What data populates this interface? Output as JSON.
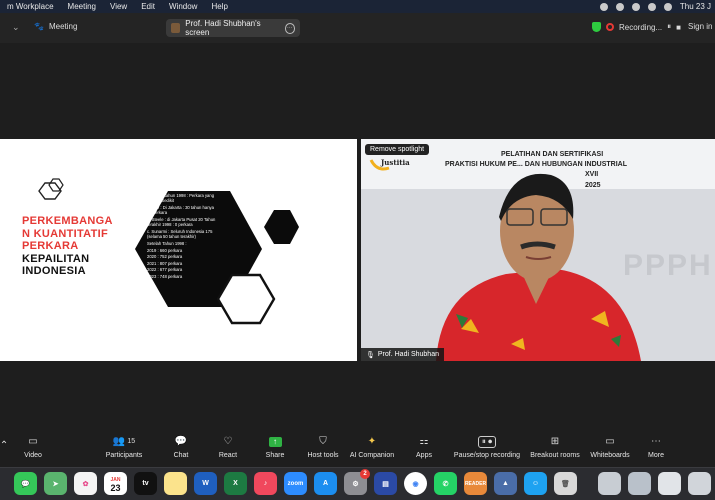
{
  "menubar": {
    "items": [
      "m Workplace",
      "Meeting",
      "View",
      "Edit",
      "Window",
      "Help"
    ],
    "clock": "Thu 23 J"
  },
  "titlebar": {
    "meeting_label": "Meeting",
    "share_pill": "Prof. Hadi Shubhan's screen",
    "recording": "Recording...",
    "sign_in": "Sign in"
  },
  "slide": {
    "title_red": [
      "PERKEMBANGA",
      "N KUANTITATIF",
      "PERKARA"
    ],
    "title_black": [
      "KEPAILITAN",
      "INDONESIA"
    ],
    "bullets": [
      "Sebelum tahun 1998 : Perkara yang Sangat Sedikit",
      "a.  Hoff : Di Jakarta : 30 tahun hanya 20 perkara",
      "b.  Steele : di Jakarta Pusat 20 Tahun terakhir 1998 : 0 perkara",
      "c.  Sunarmi : Seluruh Indonesia 175 (selama 50 tahun terakhir)",
      "Setelah Tahun 1998 :",
      "2019 : 660 perkara",
      "2020 : 752 perkara",
      "2021 : 807 perkara",
      "2022 : 677 perkara",
      "2023 : 748 perkara"
    ]
  },
  "video": {
    "spotlight_button": "Remove spotlight",
    "banner_line1": "PELATIHAN DAN SERTIFIKASI",
    "banner_line2": "PRAKTISI HUKUM PE... DAN HUBUNGAN INDUSTRIAL",
    "banner_line3": "XVII",
    "banner_line4": "2025",
    "logo_text": "Justitia",
    "bg_text": "PPPH",
    "participant_name": "Prof. Hadi Shubhan"
  },
  "toolbar": {
    "participants_count": "15",
    "items": [
      {
        "label": "Video",
        "icon": "video-icon"
      },
      {
        "label": "Participants",
        "icon": "participants-icon"
      },
      {
        "label": "Chat",
        "icon": "chat-icon"
      },
      {
        "label": "React",
        "icon": "heart-icon"
      },
      {
        "label": "Share",
        "icon": "share-icon"
      },
      {
        "label": "Host tools",
        "icon": "shield-icon"
      },
      {
        "label": "AI Companion",
        "icon": "sparkle-icon"
      },
      {
        "label": "Apps",
        "icon": "apps-icon"
      },
      {
        "label": "Pause/stop recording",
        "icon": "pause-stop-icon"
      },
      {
        "label": "Breakout rooms",
        "icon": "grid-icon"
      },
      {
        "label": "Whiteboards",
        "icon": "whiteboard-icon"
      },
      {
        "label": "More",
        "icon": "more-icon"
      }
    ]
  },
  "dock": {
    "calendar_month": "JAN",
    "calendar_day": "23",
    "settings_badge": "2",
    "apps": [
      "Messages",
      "Maps",
      "Photos",
      "Calendar",
      "Apple TV",
      "Notes",
      "Word",
      "Excel",
      "Music",
      "Zoom",
      "App Store",
      "System Settings",
      "Screens",
      "Chrome",
      "WhatsApp",
      "Reader",
      "Preview",
      "Finder",
      "Trash"
    ],
    "reader_label": "READER",
    "zoom_label": "zoom"
  },
  "colors": {
    "accent_red": "#e53935",
    "recording_green": "#2ecc40",
    "toolbar_bg": "#1e1e1e"
  }
}
